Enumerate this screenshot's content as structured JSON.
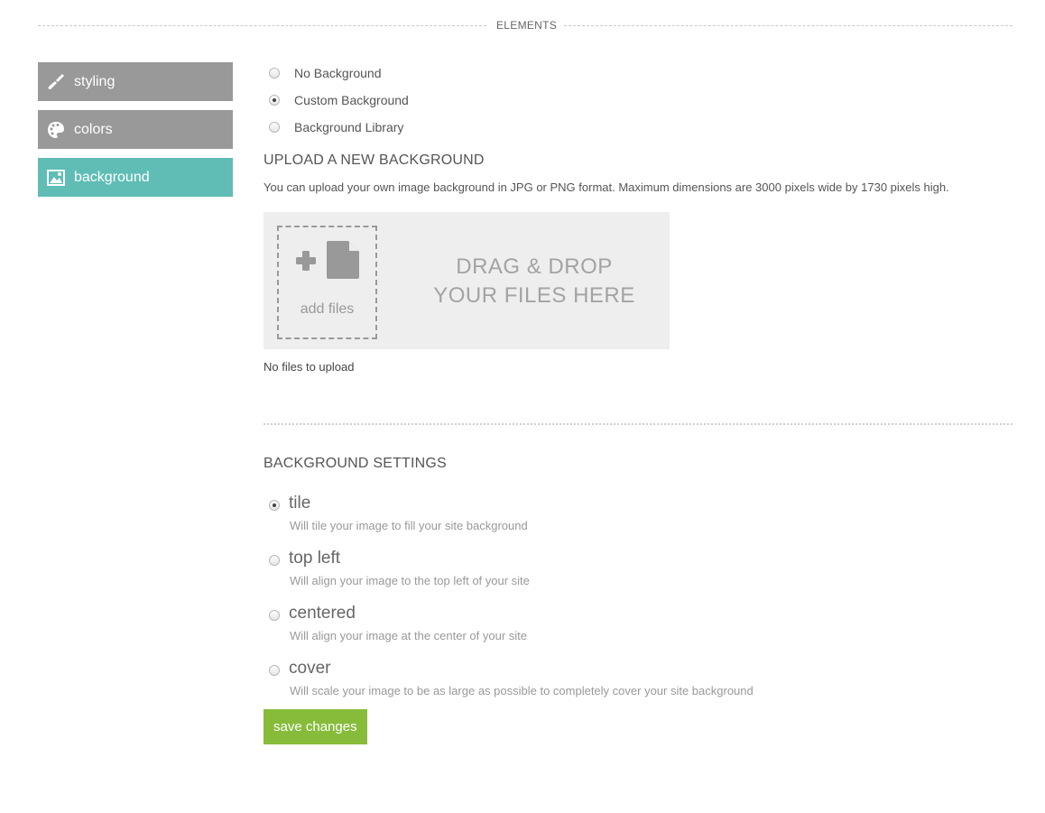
{
  "header": {
    "title": "ELEMENTS"
  },
  "sidebar": {
    "items": [
      {
        "label": "styling",
        "icon": "paintbrush-icon",
        "active": false
      },
      {
        "label": "colors",
        "icon": "palette-icon",
        "active": false
      },
      {
        "label": "background",
        "icon": "image-icon",
        "active": true
      }
    ]
  },
  "background_type": {
    "options": [
      {
        "label": "No Background",
        "checked": false
      },
      {
        "label": "Custom Background",
        "checked": true
      },
      {
        "label": "Background Library",
        "checked": false
      }
    ]
  },
  "upload": {
    "heading": "UPLOAD A NEW BACKGROUND",
    "description": "You can upload your own image background in JPG or PNG format. Maximum dimensions are 3000 pixels wide by 1730 pixels high.",
    "add_files_label": "add files",
    "drop_line1": "DRAG & DROP",
    "drop_line2": "YOUR FILES HERE",
    "status": "No files to upload"
  },
  "settings": {
    "heading": "BACKGROUND SETTINGS",
    "options": [
      {
        "name": "tile",
        "hint": "Will tile your image to fill your site background",
        "checked": true
      },
      {
        "name": "top left",
        "hint": "Will align your image to the top left of your site",
        "checked": false
      },
      {
        "name": "centered",
        "hint": "Will align your image at the center of your site",
        "checked": false
      },
      {
        "name": "cover",
        "hint": "Will scale your image to be as large as possible to completely cover your site background",
        "checked": false
      }
    ],
    "save_label": "save changes"
  },
  "colors": {
    "sidebar_inactive": "#999999",
    "sidebar_active": "#5fbdb6",
    "save_button": "#86bc3a",
    "dropzone_bg": "#eeeeee"
  }
}
